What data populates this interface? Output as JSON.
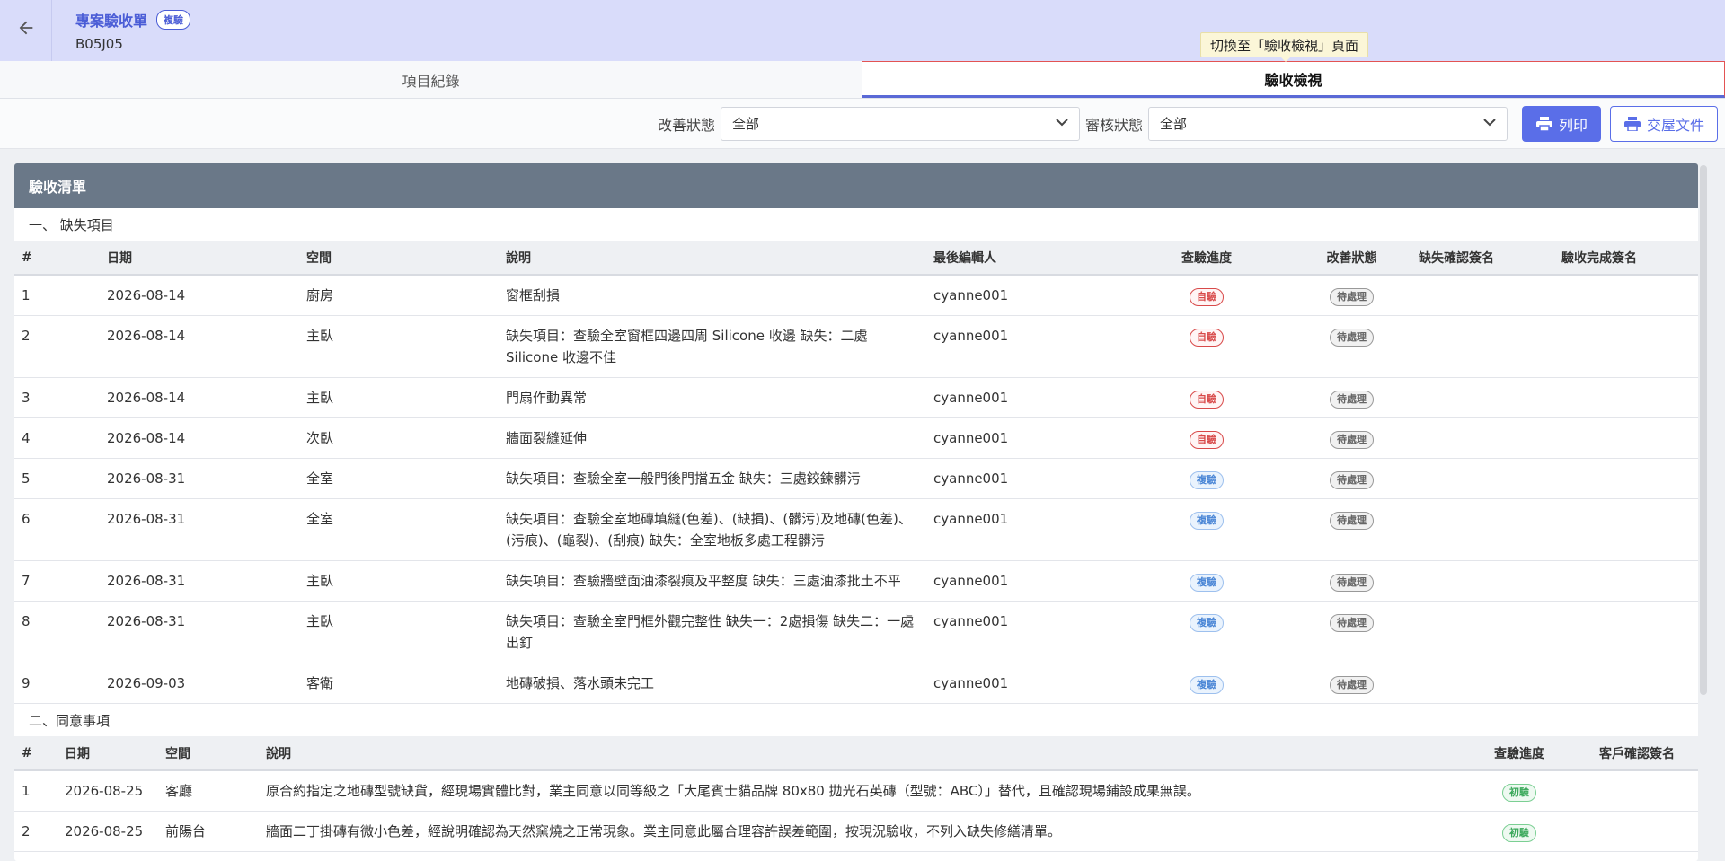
{
  "header": {
    "title": "專案驗收單",
    "badge": "複驗",
    "subtitle": "B05J05"
  },
  "tooltip": "切換至「驗收檢視」頁面",
  "tabs": [
    {
      "label": "項目紀錄"
    },
    {
      "label": "驗收檢視"
    }
  ],
  "filters": {
    "improve_label": "改善狀態",
    "improve_value": "全部",
    "review_label": "審核狀態",
    "review_value": "全部",
    "print_label": "列印",
    "handover_label": "交屋文件"
  },
  "card": {
    "title": "驗收清單"
  },
  "defects": {
    "section_title": "一、 缺失項目",
    "columns": [
      "#",
      "日期",
      "空間",
      "說明",
      "最後編輯人",
      "查驗進度",
      "改善狀態",
      "缺失確認簽名",
      "驗收完成簽名"
    ],
    "rows": [
      {
        "no": "1",
        "date": "2026-08-14",
        "space": "廚房",
        "desc": "窗框刮損",
        "editor": "cyanne001",
        "progress": "自驗",
        "status": "待處理"
      },
      {
        "no": "2",
        "date": "2026-08-14",
        "space": "主臥",
        "desc": "缺失項目：查驗全室窗框四邊四周 Silicone 收邊 缺失：二處 Silicone 收邊不佳",
        "editor": "cyanne001",
        "progress": "自驗",
        "status": "待處理"
      },
      {
        "no": "3",
        "date": "2026-08-14",
        "space": "主臥",
        "desc": "門扇作動異常",
        "editor": "cyanne001",
        "progress": "自驗",
        "status": "待處理"
      },
      {
        "no": "4",
        "date": "2026-08-14",
        "space": "次臥",
        "desc": "牆面裂縫延伸",
        "editor": "cyanne001",
        "progress": "自驗",
        "status": "待處理"
      },
      {
        "no": "5",
        "date": "2026-08-31",
        "space": "全室",
        "desc": "缺失項目：查驗全室一般門後門擋五金 缺失：三處鉸鍊髒污",
        "editor": "cyanne001",
        "progress": "複驗",
        "status": "待處理"
      },
      {
        "no": "6",
        "date": "2026-08-31",
        "space": "全室",
        "desc": "缺失項目：查驗全室地磚填縫(色差)、(缺損)、(髒污)及地磚(色差)、(污痕)、(龜裂)、(刮痕) 缺失：全室地板多處工程髒污",
        "editor": "cyanne001",
        "progress": "複驗",
        "status": "待處理"
      },
      {
        "no": "7",
        "date": "2026-08-31",
        "space": "主臥",
        "desc": "缺失項目：查驗牆壁面油漆裂痕及平整度 缺失：三處油漆批土不平",
        "editor": "cyanne001",
        "progress": "複驗",
        "status": "待處理"
      },
      {
        "no": "8",
        "date": "2026-08-31",
        "space": "主臥",
        "desc": "缺失項目：查驗全室門框外觀完整性 缺失一：2處損傷 缺失二：一處出釘",
        "editor": "cyanne001",
        "progress": "複驗",
        "status": "待處理"
      },
      {
        "no": "9",
        "date": "2026-09-03",
        "space": "客衛",
        "desc": "地磚破損、落水頭未完工",
        "editor": "cyanne001",
        "progress": "複驗",
        "status": "待處理"
      }
    ]
  },
  "agreements": {
    "section_title": "二、同意事項",
    "columns": [
      "#",
      "日期",
      "空間",
      "說明",
      "查驗進度",
      "客戶確認簽名"
    ],
    "rows": [
      {
        "no": "1",
        "date": "2026-08-25",
        "space": "客廳",
        "desc": "原合約指定之地磚型號缺貨，經現場實體比對，業主同意以同等級之「大尾賓士貓品牌 80x80 拋光石英磚（型號：ABC）」替代，且確認現場鋪設成果無誤。",
        "progress": "初驗"
      },
      {
        "no": "2",
        "date": "2026-08-25",
        "space": "前陽台",
        "desc": "牆面二丁掛磚有微小色差，經說明確認為天然窯燒之正常現象。業主同意此屬合理容許誤差範圍，按現況驗收，不列入缺失修繕清單。",
        "progress": "初驗"
      }
    ]
  },
  "colors": {
    "accent": "#5a6ee8",
    "header_bg": "#d9dcfa",
    "card_header": "#6a7888"
  }
}
